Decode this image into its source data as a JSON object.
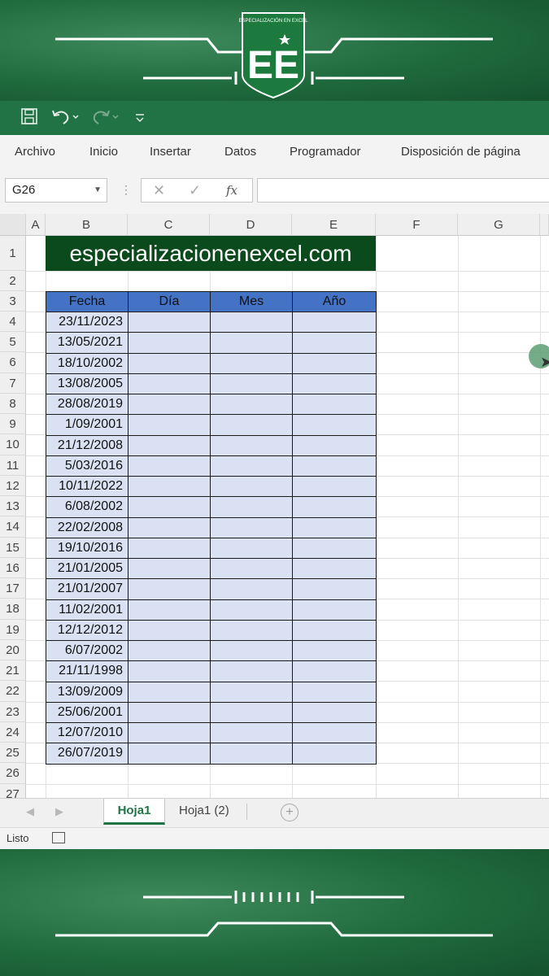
{
  "brand": {
    "badge_text": "ESPECIALIZACIÓN EN EXCEL",
    "logo_letters": "EE"
  },
  "quick_access": {
    "save_icon": "save-icon",
    "undo_icon": "undo-icon",
    "redo_icon": "redo-icon",
    "customize_icon": "customize-toolbar-icon"
  },
  "ribbon": {
    "tabs": [
      "Archivo",
      "Inicio",
      "Insertar",
      "Datos",
      "Programador",
      "Disposición de página"
    ]
  },
  "formula_bar": {
    "name_box": "G26",
    "formula": "",
    "cancel_icon": "cancel-icon",
    "enter_icon": "check-icon",
    "fx_label": "fx"
  },
  "columns": [
    "A",
    "B",
    "C",
    "D",
    "E",
    "F",
    "G"
  ],
  "rows": [
    "1",
    "2",
    "3",
    "4",
    "5",
    "6",
    "7",
    "8",
    "9",
    "10",
    "11",
    "12",
    "13",
    "14",
    "15",
    "16",
    "17",
    "18",
    "19",
    "20",
    "21",
    "22",
    "23",
    "24",
    "25",
    "26",
    "27"
  ],
  "title_cell": "especializacionenexcel.com",
  "table": {
    "headers": [
      "Fecha",
      "Día",
      "Mes",
      "Año"
    ],
    "dates": [
      "23/11/2023",
      "13/05/2021",
      "18/10/2002",
      "13/08/2005",
      "28/08/2019",
      "1/09/2001",
      "21/12/2008",
      "5/03/2016",
      "10/11/2022",
      "6/08/2002",
      "22/02/2008",
      "19/10/2016",
      "21/01/2005",
      "21/01/2007",
      "11/02/2001",
      "12/12/2012",
      "6/07/2002",
      "21/11/1998",
      "13/09/2009",
      "25/06/2001",
      "12/07/2010",
      "26/07/2019"
    ]
  },
  "sheets": {
    "tabs": [
      "Hoja1",
      "Hoja1 (2)"
    ],
    "active": "Hoja1"
  },
  "status": {
    "text": "Listo"
  },
  "colors": {
    "excel_green": "#217346",
    "title_fill": "#0b4a1d",
    "header_fill": "#4472c4",
    "body_fill": "#d9e1f2"
  }
}
